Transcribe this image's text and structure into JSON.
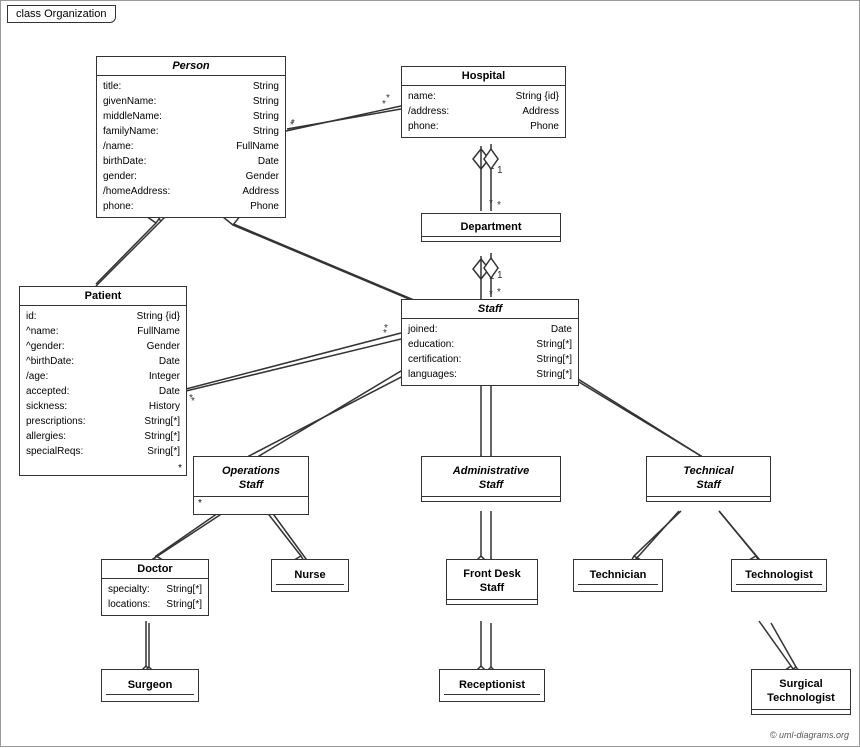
{
  "title": "class Organization",
  "copyright": "© uml-diagrams.org",
  "classes": {
    "person": {
      "name": "Person",
      "italic": true,
      "attrs": [
        [
          "title:",
          "String"
        ],
        [
          "givenName:",
          "String"
        ],
        [
          "middleName:",
          "String"
        ],
        [
          "familyName:",
          "String"
        ],
        [
          "/name:",
          "FullName"
        ],
        [
          "birthDate:",
          "Date"
        ],
        [
          "gender:",
          "Gender"
        ],
        [
          "/homeAddress:",
          "Address"
        ],
        [
          "phone:",
          "Phone"
        ]
      ]
    },
    "hospital": {
      "name": "Hospital",
      "italic": false,
      "attrs": [
        [
          "name:",
          "String {id}"
        ],
        [
          "/address:",
          "Address"
        ],
        [
          "phone:",
          "Phone"
        ]
      ]
    },
    "department": {
      "name": "Department",
      "italic": false,
      "attrs": []
    },
    "patient": {
      "name": "Patient",
      "italic": false,
      "attrs": [
        [
          "id:",
          "String {id}"
        ],
        [
          "^name:",
          "FullName"
        ],
        [
          "^gender:",
          "Gender"
        ],
        [
          "^birthDate:",
          "Date"
        ],
        [
          "/age:",
          "Integer"
        ],
        [
          "accepted:",
          "Date"
        ],
        [
          "sickness:",
          "History"
        ],
        [
          "prescriptions:",
          "String[*]"
        ],
        [
          "allergies:",
          "String[*]"
        ],
        [
          "specialReqs:",
          "Sring[*]"
        ]
      ]
    },
    "staff": {
      "name": "Staff",
      "italic": true,
      "attrs": [
        [
          "joined:",
          "Date"
        ],
        [
          "education:",
          "String[*]"
        ],
        [
          "certification:",
          "String[*]"
        ],
        [
          "languages:",
          "String[*]"
        ]
      ]
    },
    "operations_staff": {
      "name": "Operations\nStaff",
      "italic": true,
      "attrs": []
    },
    "administrative_staff": {
      "name": "Administrative\nStaff",
      "italic": true,
      "attrs": []
    },
    "technical_staff": {
      "name": "Technical\nStaff",
      "italic": true,
      "attrs": []
    },
    "doctor": {
      "name": "Doctor",
      "italic": false,
      "attrs": [
        [
          "specialty:",
          "String[*]"
        ],
        [
          "locations:",
          "String[*]"
        ]
      ]
    },
    "nurse": {
      "name": "Nurse",
      "italic": false,
      "attrs": []
    },
    "front_desk_staff": {
      "name": "Front Desk\nStaff",
      "italic": false,
      "attrs": []
    },
    "technician": {
      "name": "Technician",
      "italic": false,
      "attrs": []
    },
    "technologist": {
      "name": "Technologist",
      "italic": false,
      "attrs": []
    },
    "surgeon": {
      "name": "Surgeon",
      "italic": false,
      "attrs": []
    },
    "receptionist": {
      "name": "Receptionist",
      "italic": false,
      "attrs": []
    },
    "surgical_technologist": {
      "name": "Surgical\nTechnologist",
      "italic": false,
      "attrs": []
    }
  }
}
